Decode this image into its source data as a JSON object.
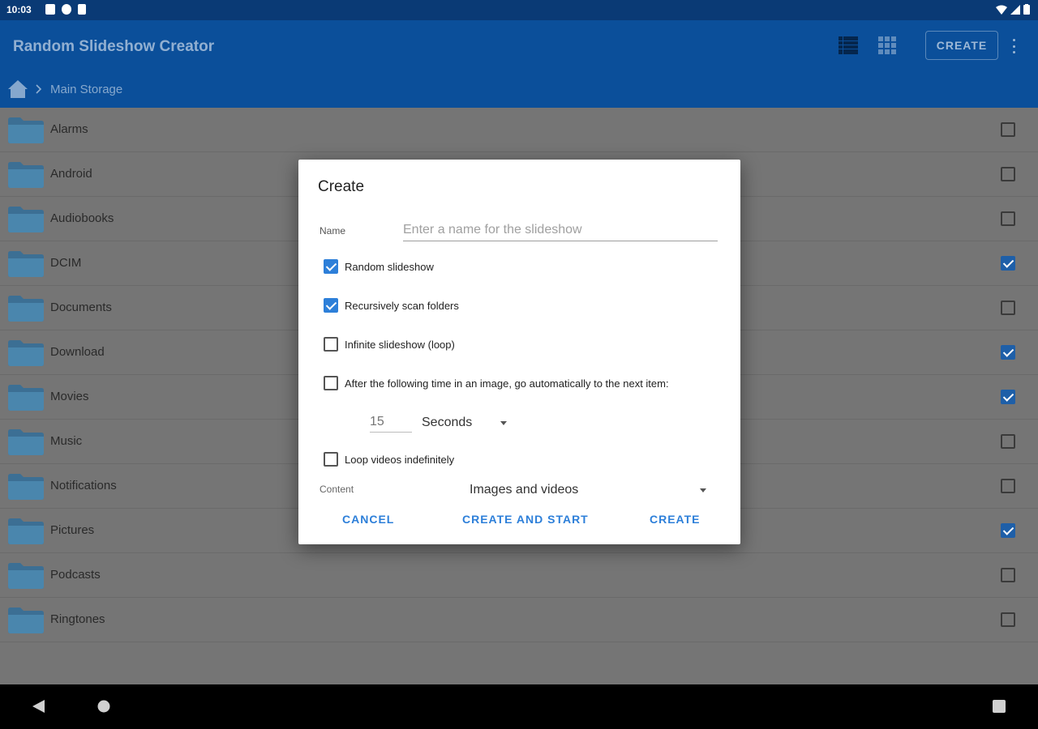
{
  "status_bar": {
    "time": "10:03"
  },
  "app_bar": {
    "title": "Random Slideshow Creator",
    "create_label": "CREATE",
    "breadcrumb": "Main Storage"
  },
  "folders": [
    {
      "name": "Alarms",
      "checked": false
    },
    {
      "name": "Android",
      "checked": false
    },
    {
      "name": "Audiobooks",
      "checked": false
    },
    {
      "name": "DCIM",
      "checked": true
    },
    {
      "name": "Documents",
      "checked": false
    },
    {
      "name": "Download",
      "checked": true
    },
    {
      "name": "Movies",
      "checked": true
    },
    {
      "name": "Music",
      "checked": false
    },
    {
      "name": "Notifications",
      "checked": false
    },
    {
      "name": "Pictures",
      "checked": true
    },
    {
      "name": "Podcasts",
      "checked": false
    },
    {
      "name": "Ringtones",
      "checked": false
    }
  ],
  "dialog": {
    "title": "Create",
    "name_label": "Name",
    "name_placeholder": "Enter a name for the slideshow",
    "name_value": "",
    "options": {
      "random": {
        "label": "Random slideshow",
        "checked": true
      },
      "recursive": {
        "label": "Recursively scan folders",
        "checked": true
      },
      "infinite": {
        "label": "Infinite slideshow (loop)",
        "checked": false
      },
      "auto_next": {
        "label": "After the following time in an image, go automatically to the next item:",
        "checked": false
      },
      "loop_videos": {
        "label": "Loop videos indefinitely",
        "checked": false
      }
    },
    "seconds_value": "15",
    "unit": "Seconds",
    "content_label": "Content",
    "content_value": "Images and videos",
    "buttons": {
      "cancel": "CANCEL",
      "create_and_start": "CREATE AND START",
      "create": "CREATE"
    }
  },
  "colors": {
    "app_bar": "#0b4f9a",
    "status_bar": "#0a3a75",
    "accent": "#2d7fd9"
  }
}
